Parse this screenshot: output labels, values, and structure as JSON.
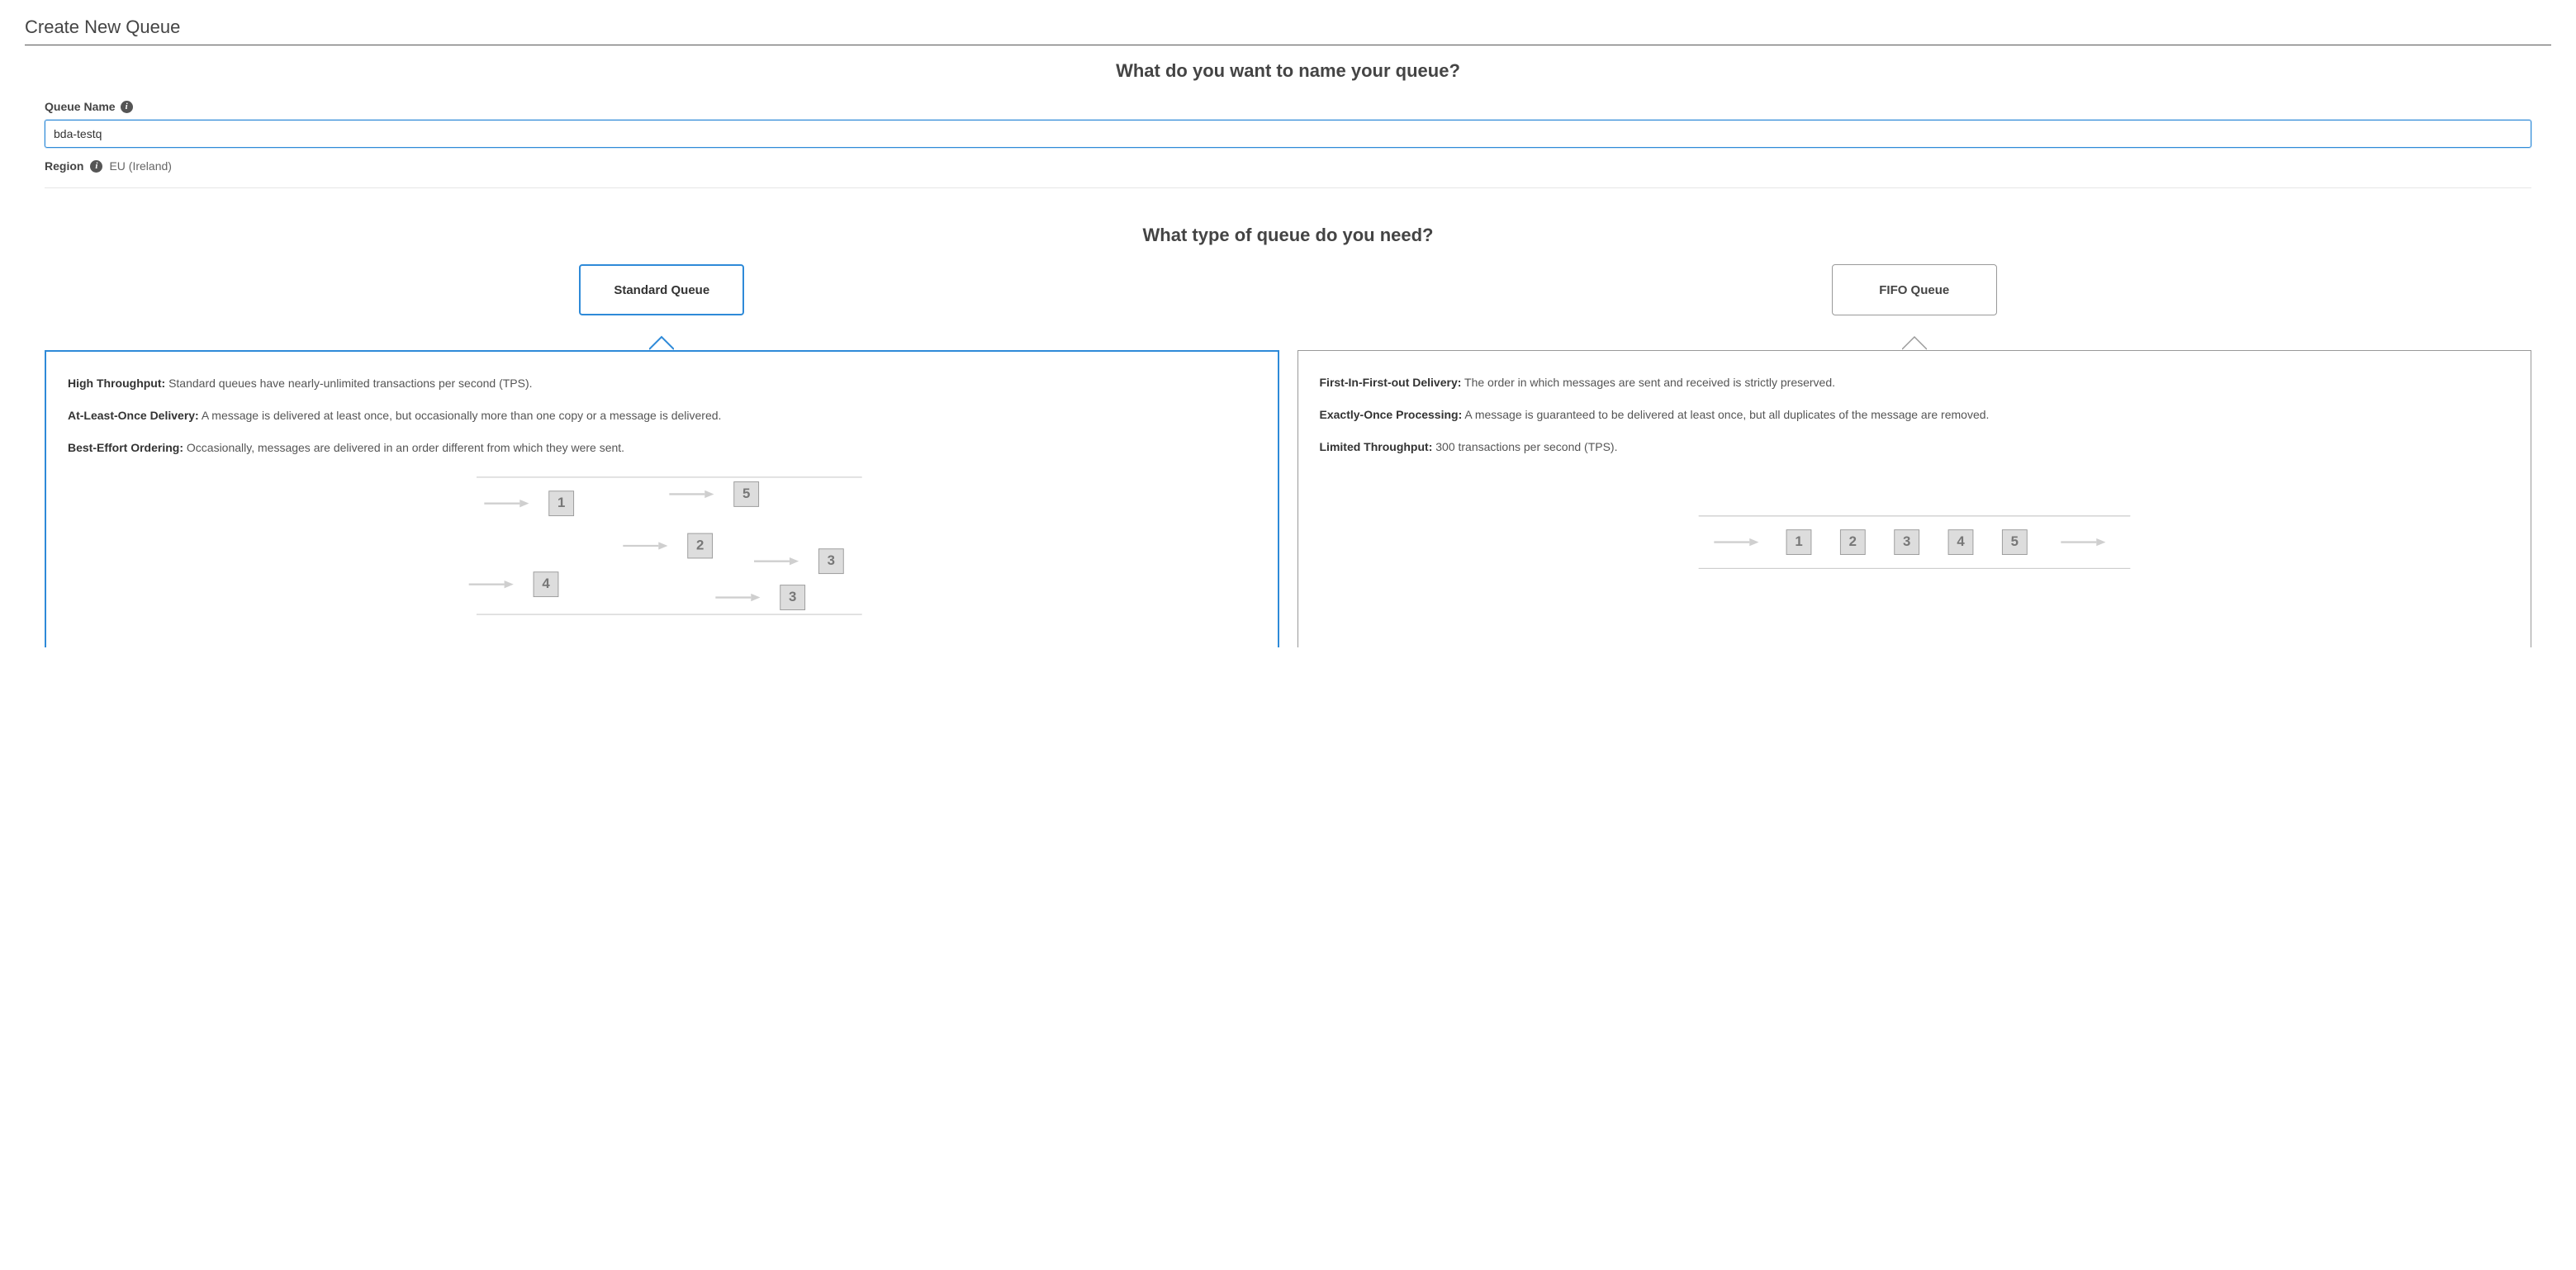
{
  "page_title": "Create New Queue",
  "section1": {
    "heading": "What do you want to name your queue?",
    "queue_name_label": "Queue Name",
    "queue_name_value": "bda-testq",
    "region_label": "Region",
    "region_value": "EU (Ireland)"
  },
  "section2": {
    "heading": "What type of queue do you need?",
    "standard": {
      "button_label": "Standard Queue",
      "features": [
        {
          "title": "High Throughput:",
          "body": " Standard queues have nearly-unlimited transactions per second (TPS)."
        },
        {
          "title": "At-Least-Once Delivery:",
          "body": " A message is delivered at least once, but occasionally more than one copy or a message is delivered."
        },
        {
          "title": "Best-Effort Ordering:",
          "body": " Occasionally, messages are delivered in an order different from which they were sent."
        }
      ],
      "diagram_numbers": [
        "1",
        "5",
        "2",
        "3",
        "4",
        "3"
      ]
    },
    "fifo": {
      "button_label": "FIFO Queue",
      "features": [
        {
          "title": "First-In-First-out Delivery:",
          "body": " The order in which messages are sent and received is strictly preserved."
        },
        {
          "title": "Exactly-Once Processing:",
          "body": " A message is guaranteed to be delivered at least once, but all duplicates of the message are removed."
        },
        {
          "title": "Limited Throughput:",
          "body": " 300 transactions per second (TPS)."
        }
      ],
      "diagram_numbers": [
        "1",
        "2",
        "3",
        "4",
        "5"
      ]
    }
  }
}
